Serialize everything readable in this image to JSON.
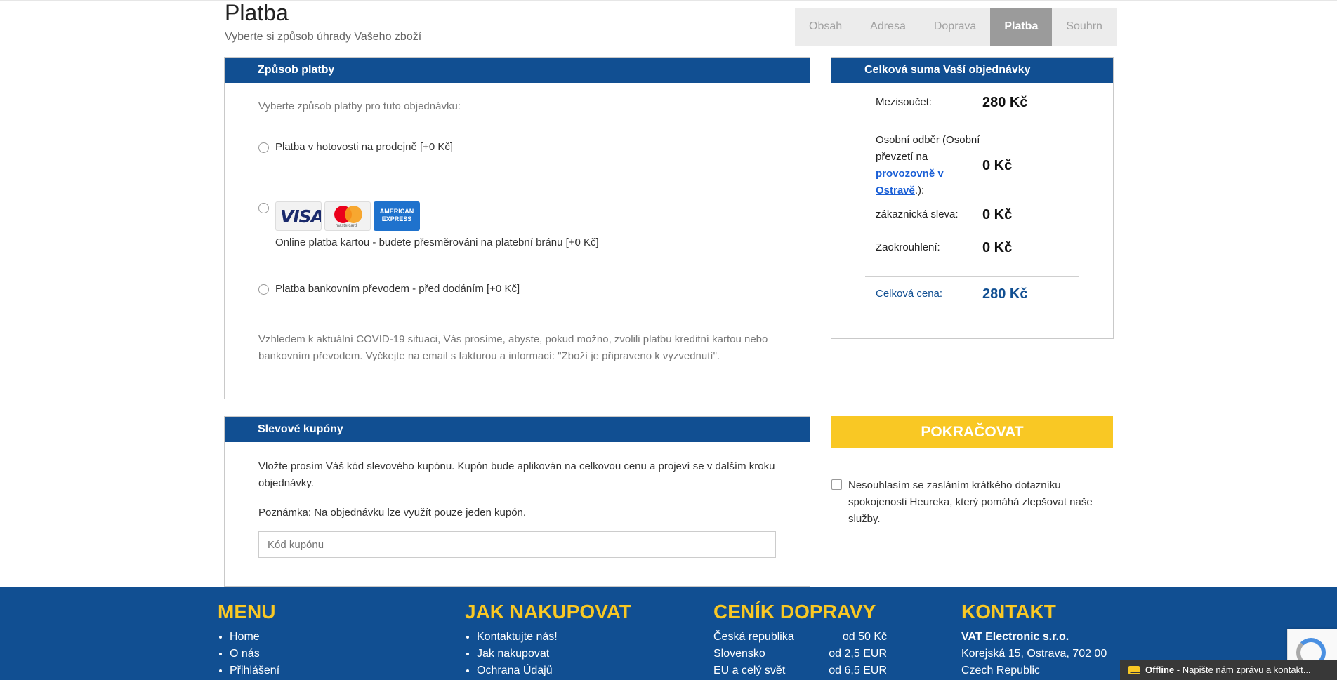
{
  "header": {
    "title": "Platba",
    "subtitle": "Vyberte si způsob úhrady Vašeho zboží"
  },
  "steps": [
    {
      "label": "Obsah",
      "active": false
    },
    {
      "label": "Adresa",
      "active": false
    },
    {
      "label": "Doprava",
      "active": false
    },
    {
      "label": "Platba",
      "active": true
    },
    {
      "label": "Souhrn",
      "active": false
    }
  ],
  "payment": {
    "heading": "Způsob platby",
    "intro": "Vyberte způsob platby pro tuto objednávku:",
    "options": [
      {
        "label": "Platba v hotovosti na prodejně [+0 Kč]"
      },
      {
        "label": "Online platba kartou - budete přesměrováni na platební bránu [+0 Kč]",
        "cards": [
          "VISA",
          "mastercard",
          "AMERICAN EXPRESS"
        ]
      },
      {
        "label": "Platba bankovním převodem - před dodáním [+0 Kč]"
      }
    ],
    "covid_note": "Vzhledem k aktuální COVID-19 situaci, Vás prosíme, abyste, pokud možno, zvolili platbu kreditní kartou nebo bankovním převodem. Vyčkejte na email s fakturou a informací: \"Zboží je připraveno k vyzvednutí\"."
  },
  "coupons": {
    "heading": "Slevové kupóny",
    "text1": "Vložte prosím Váš kód slevového kupónu. Kupón bude aplikován na celkovou cenu a projeví se v dalším kroku objednávky.",
    "text2": "Poznámka: Na objednávku lze využít pouze jeden kupón.",
    "input_placeholder": "Kód kupónu"
  },
  "summary": {
    "heading": "Celková suma Vaší objednávky",
    "subtotal_label": "Mezisoučet:",
    "subtotal_value": "280 Kč",
    "pickup_label_pre": "Osobní odběr (Osobní převzetí na ",
    "pickup_link": "provozovně v Ostravě",
    "pickup_label_post": ".):",
    "pickup_value": "0 Kč",
    "discount_label": "zákaznická sleva:",
    "discount_value": "0 Kč",
    "rounding_label": "Zaokrouhlení:",
    "rounding_value": "0 Kč",
    "total_label": "Celková cena:",
    "total_value": "280 Kč"
  },
  "actions": {
    "continue_label": "POKRAČOVAT",
    "consent_label": "Nesouhlasím se zasláním krátkého dotazníku spokojenosti Heureka, který pomáhá zlepšovat naše služby."
  },
  "footer": {
    "menu": {
      "title": "MENU",
      "items": [
        "Home",
        "O nás",
        "Přihlášení"
      ]
    },
    "how": {
      "title": "JAK NAKUPOVAT",
      "items": [
        "Kontaktujte nás!",
        "Jak nakupovat",
        "Ochrana Údajů"
      ]
    },
    "shipping": {
      "title": "CENÍK DOPRAVY",
      "rows": [
        {
          "country": "Česká republika",
          "price": "od 50 Kč"
        },
        {
          "country": "Slovensko",
          "price": "od 2,5 EUR"
        },
        {
          "country": "EU a celý svět",
          "price": "od 6,5 EUR"
        }
      ]
    },
    "contact": {
      "title": "KONTAKT",
      "company": "VAT Electronic s.r.o.",
      "street": "Korejská 15, Ostrava, 702 00",
      "country": "Czech Republic"
    }
  },
  "chat": {
    "status": "Offline",
    "text": " - Napište nám zprávu a kontakt..."
  },
  "colors": {
    "primary": "#114f92",
    "accent": "#f9c824",
    "step_active": "#9b9b9b"
  }
}
